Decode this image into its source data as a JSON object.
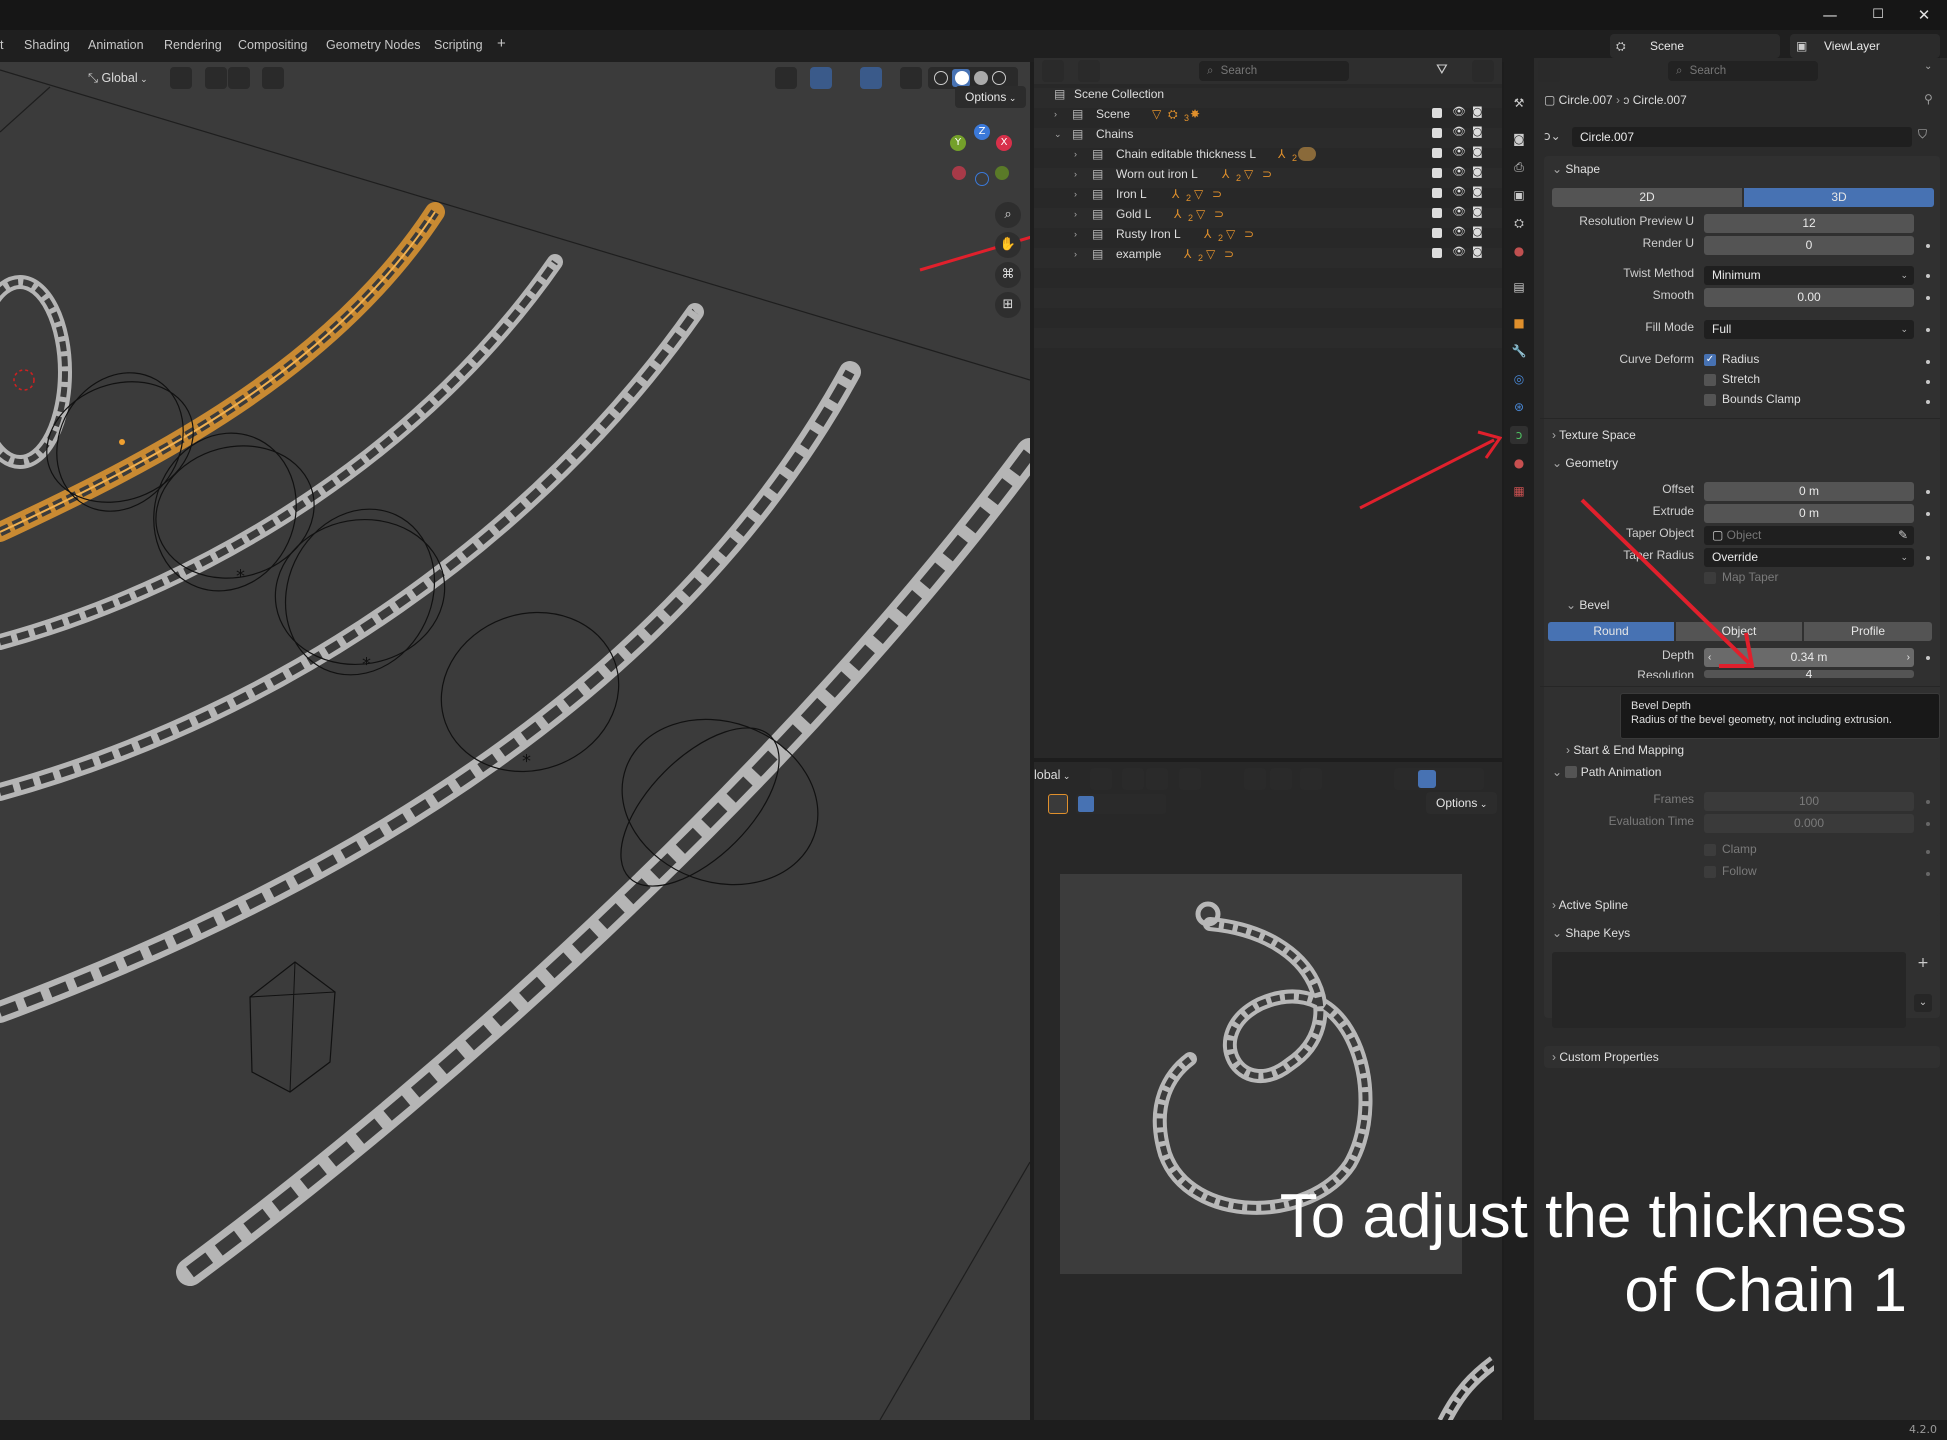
{
  "workspace_tabs": [
    "t",
    "Shading",
    "Animation",
    "Rendering",
    "Compositing",
    "Geometry Nodes",
    "Scripting",
    "+"
  ],
  "scene": {
    "name": "Scene",
    "view_layer": "ViewLayer"
  },
  "window_controls": {
    "minimize": "—",
    "maximize": "☐",
    "close": "✕"
  },
  "viewport": {
    "orientation": "Global",
    "options_label": "Options"
  },
  "outliner": {
    "search_placeholder": "Search",
    "root": "Scene Collection",
    "rows": [
      {
        "label": "Scene",
        "badge": "3"
      },
      {
        "label": "Chains"
      },
      {
        "label": "Chain editable thickness L",
        "badge": "2"
      },
      {
        "label": "Worn out iron L",
        "badge": "2"
      },
      {
        "label": "Iron L",
        "badge": "2"
      },
      {
        "label": "Gold L",
        "badge": "2"
      },
      {
        "label": "Rusty Iron L",
        "badge": "2"
      },
      {
        "label": "example",
        "badge": "2"
      }
    ]
  },
  "viewport2": {
    "orientation": "lobal",
    "options_label": "Options"
  },
  "properties": {
    "search_placeholder": "Search",
    "breadcrumb": [
      "Circle.007",
      "Circle.007"
    ],
    "datablock_name": "Circle.007",
    "shape": {
      "title": "Shape",
      "dim_2d": "2D",
      "dim_3d": "3D",
      "resolution_preview_label": "Resolution Preview U",
      "resolution_preview_value": "12",
      "render_u_label": "Render U",
      "render_u_value": "0",
      "twist_method_label": "Twist Method",
      "twist_method_value": "Minimum",
      "smooth_label": "Smooth",
      "smooth_value": "0.00",
      "fill_mode_label": "Fill Mode",
      "fill_mode_value": "Full",
      "curve_deform_label": "Curve Deform",
      "radius_label": "Radius",
      "stretch_label": "Stretch",
      "bounds_clamp_label": "Bounds Clamp"
    },
    "texture_space": "Texture Space",
    "geometry": {
      "title": "Geometry",
      "offset_label": "Offset",
      "offset_value": "0 m",
      "extrude_label": "Extrude",
      "extrude_value": "0 m",
      "taper_object_label": "Taper Object",
      "taper_object_placeholder": "Object",
      "taper_radius_label": "Taper Radius",
      "taper_radius_value": "Override",
      "map_taper_label": "Map Taper"
    },
    "bevel": {
      "title": "Bevel",
      "mode_round": "Round",
      "mode_object": "Object",
      "mode_profile": "Profile",
      "depth_label": "Depth",
      "depth_value": "0.34 m",
      "resolution_label": "Resolution",
      "resolution_value": "4"
    },
    "tooltip": {
      "title": "Bevel Depth",
      "text": "Radius of the bevel geometry, not including extrusion."
    },
    "start_end_mapping": "Start & End Mapping",
    "path_animation": {
      "title": "Path Animation",
      "frames_label": "Frames",
      "frames_value": "100",
      "eval_time_label": "Evaluation Time",
      "eval_time_value": "0.000",
      "clamp_label": "Clamp",
      "follow_label": "Follow"
    },
    "active_spline": "Active Spline",
    "shape_keys": "Shape Keys",
    "custom_properties": "Custom Properties"
  },
  "overlay_caption": {
    "line1": "To adjust the thickness",
    "line2": "of Chain 1"
  },
  "version": "4.2.0",
  "colors": {
    "accent_blue": "#4772b3",
    "selected_orange": "#e8a23c",
    "arrow_red": "#e0202c",
    "chain_gray": "#bdbdbd"
  }
}
